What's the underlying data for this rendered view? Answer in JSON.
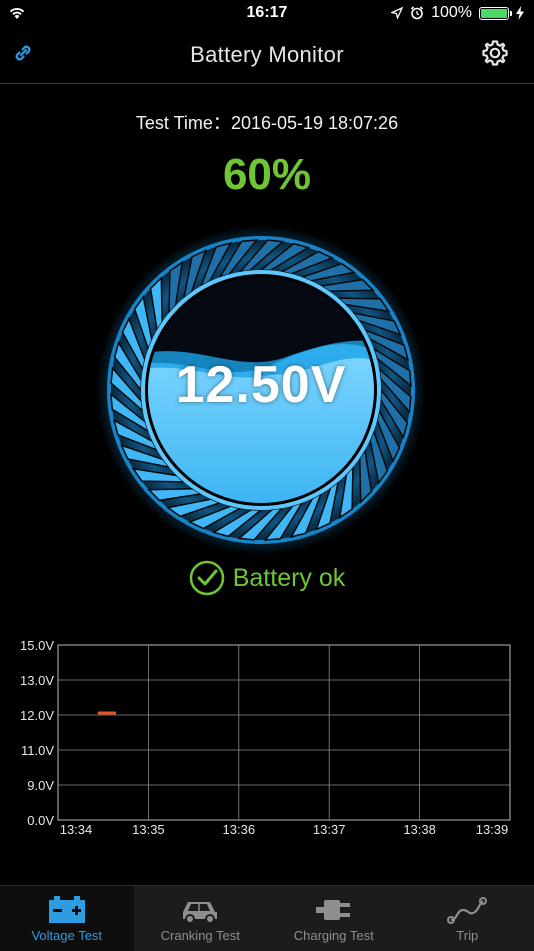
{
  "status_bar": {
    "time": "16:17",
    "battery_percent": "100%"
  },
  "navbar": {
    "title": "Battery Monitor",
    "left_icon": "link-icon",
    "right_icon": "gear-icon"
  },
  "test_time": {
    "label": "Test Time：",
    "value": "2016-05-19 18:07:26"
  },
  "charge_percent": "60%",
  "gauge": {
    "fill_level": 0.55,
    "accent": "#3fb6f5"
  },
  "voltage": "12.50V",
  "health": {
    "text": "Battery ok",
    "icon": "check-circle-icon",
    "color": "#6fc534"
  },
  "chart_data": {
    "type": "line",
    "y_ticks": [
      "15.0V",
      "13.0V",
      "12.0V",
      "11.0V",
      "9.0V",
      "0.0V"
    ],
    "x_ticks": [
      "13:34",
      "13:35",
      "13:36",
      "13:37",
      "13:38",
      "13:39"
    ],
    "grid": true,
    "series": [
      {
        "color": "#e8561e",
        "points": [
          {
            "x": "13:34",
            "y": 12.0
          }
        ]
      }
    ]
  },
  "tabs": [
    {
      "label": "Voltage Test",
      "icon": "battery-icon",
      "active": true
    },
    {
      "label": "Cranking Test",
      "icon": "car-icon",
      "active": false
    },
    {
      "label": "Charging Test",
      "icon": "plug-icon",
      "active": false
    },
    {
      "label": "Trip",
      "icon": "route-icon",
      "active": false
    }
  ]
}
